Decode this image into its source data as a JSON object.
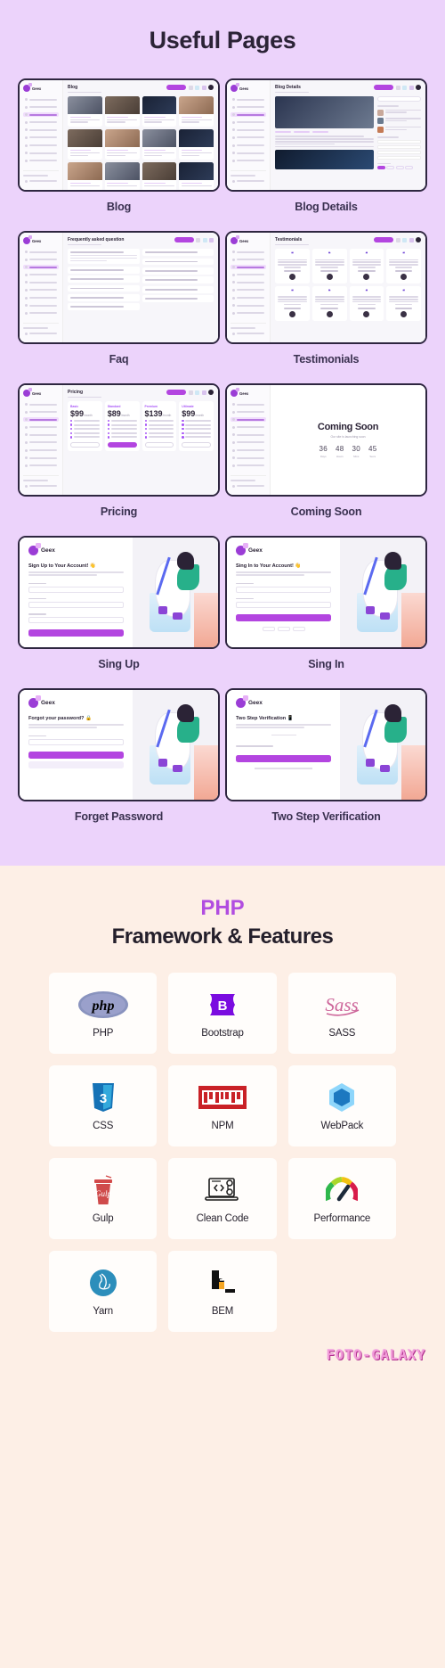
{
  "theme": {
    "pages_bg": "#ecd3fb",
    "php_bg": "#fdefe6",
    "accent_purple": "#b345e0",
    "heading_dark": "#2b2336"
  },
  "pages_section": {
    "title": "Useful Pages",
    "items": [
      {
        "label": "Blog",
        "mock": "blog"
      },
      {
        "label": "Blog Details",
        "mock": "blog-details"
      },
      {
        "label": "Faq",
        "mock": "faq"
      },
      {
        "label": "Testimonials",
        "mock": "testimonials"
      },
      {
        "label": "Pricing",
        "mock": "pricing"
      },
      {
        "label": "Coming Soon",
        "mock": "coming-soon"
      },
      {
        "label": "Sing Up",
        "mock": "sign-up"
      },
      {
        "label": "Sing In",
        "mock": "sign-in"
      },
      {
        "label": "Forget Password",
        "mock": "forget-password"
      },
      {
        "label": "Two Step Verification",
        "mock": "two-step-verification"
      }
    ],
    "mock_common": {
      "brand": "Geex",
      "cta_label": "",
      "nav_count": 9
    },
    "mock_titles": {
      "blog": "Blog",
      "blog_details": "Blog Details",
      "faq": "Frequently asked question",
      "testimonials": "Testimonials",
      "pricing": "Pricing"
    },
    "pricing": {
      "plans": [
        {
          "tag": "Basic",
          "price": "$99",
          "period": "/month",
          "featured": false
        },
        {
          "tag": "Standard",
          "price": "$89",
          "period": "/month",
          "featured": true
        },
        {
          "tag": "Premium",
          "price": "$139",
          "period": "/month",
          "featured": false
        },
        {
          "tag": "Ultimate",
          "price": "$99",
          "period": "/month",
          "featured": false
        }
      ]
    },
    "coming_soon": {
      "title": "Coming Soon",
      "subtitle": "Our site is launching soon",
      "countdown": [
        {
          "value": "36",
          "unit": "Days"
        },
        {
          "value": "48",
          "unit": "Hours"
        },
        {
          "value": "30",
          "unit": "Mins"
        },
        {
          "value": "45",
          "unit": "Secs"
        }
      ]
    },
    "auth": {
      "sign_up_heading": "Sign Up to Your Account! 👋",
      "sign_in_heading": "Sing In to Your Account! 👋",
      "forget_heading": "Forgot your password? 🔒",
      "two_step_heading": "Two Step Verification 📱",
      "brand": "Geex"
    }
  },
  "php_section": {
    "kicker": "PHP",
    "title": "Framework & Features",
    "tech": [
      {
        "label": "PHP",
        "icon": "php-icon"
      },
      {
        "label": "Bootstrap",
        "icon": "bootstrap-icon"
      },
      {
        "label": "SASS",
        "icon": "sass-icon"
      },
      {
        "label": "CSS",
        "icon": "css3-icon"
      },
      {
        "label": "NPM",
        "icon": "npm-icon"
      },
      {
        "label": "WebPack",
        "icon": "webpack-icon"
      },
      {
        "label": "Gulp",
        "icon": "gulp-icon"
      },
      {
        "label": "Clean Code",
        "icon": "clean-code-icon"
      },
      {
        "label": "Performance",
        "icon": "performance-gauge-icon"
      },
      {
        "label": "Yarn",
        "icon": "yarn-icon"
      },
      {
        "label": "BEM",
        "icon": "bem-icon"
      }
    ]
  },
  "watermark": {
    "text": "FOTO-GALAXY"
  }
}
